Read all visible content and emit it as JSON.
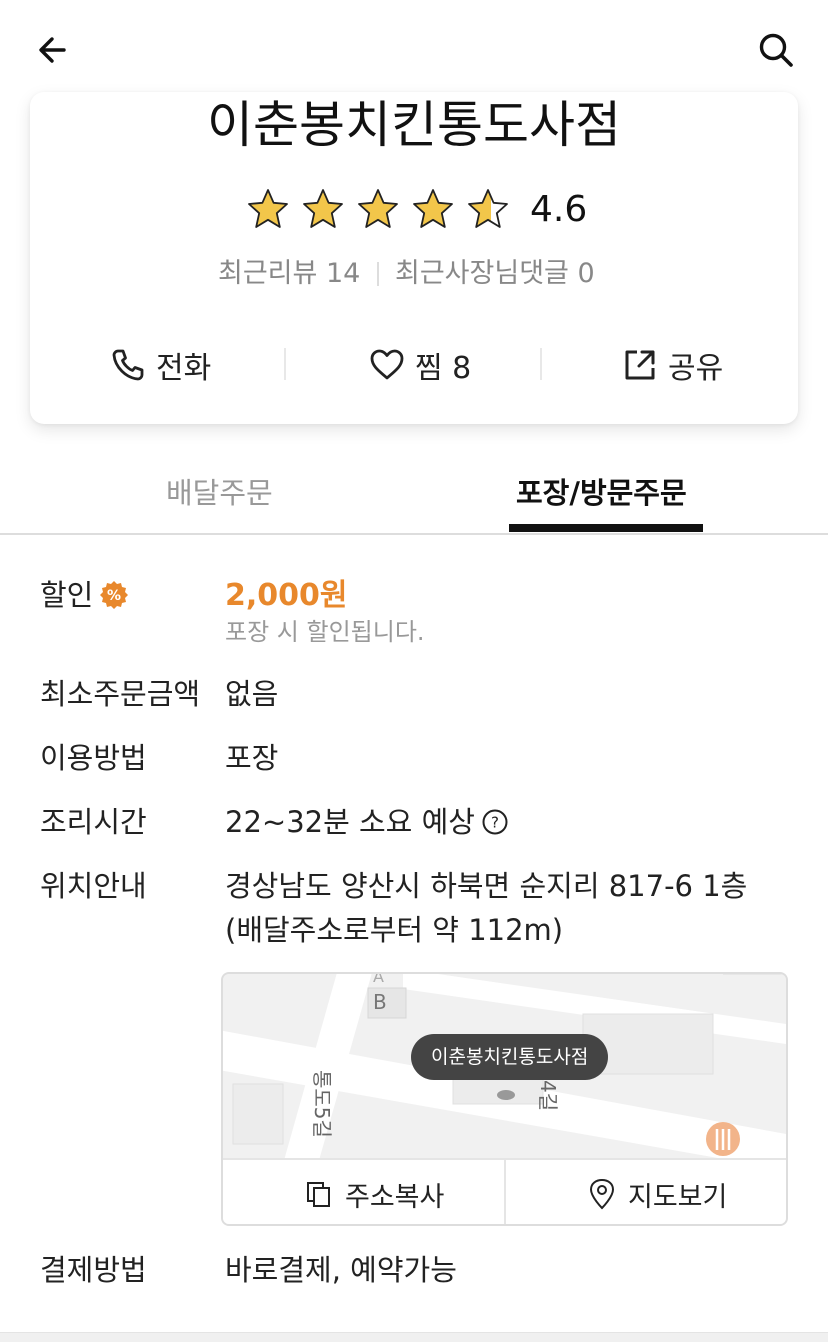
{
  "header": {
    "back_icon": "arrow-left-icon",
    "search_icon": "search-icon"
  },
  "store": {
    "name": "이춘봉치킨통도사점",
    "rating": 4.6,
    "rating_text": "4.6",
    "recent_reviews": "최근리뷰 14",
    "recent_owner_replies": "최근사장님댓글 0"
  },
  "actions": [
    {
      "label": "전화",
      "icon": "phone-icon"
    },
    {
      "label": "찜 8",
      "icon": "heart-icon"
    },
    {
      "label": "공유",
      "icon": "share-icon"
    }
  ],
  "tabs": [
    {
      "label": "배달주문",
      "active": false
    },
    {
      "label": "포장/방문주문",
      "active": true
    }
  ],
  "info": {
    "discount_label": "할인",
    "discount_value": "2,000원",
    "discount_note": "포장 시 할인됩니다.",
    "min_order_label": "최소주문금액",
    "min_order_value": "없음",
    "usage_label": "이용방법",
    "usage_value": "포장",
    "cook_time_label": "조리시간",
    "cook_time_value": "22~32분 소요 예상",
    "location_label": "위치안내",
    "address_line1": "경상남도 양산시 하북면 순지리 817-6 1층",
    "address_line2": "(배달주소로부터 약 112m)",
    "payment_label": "결제방법",
    "payment_value": "바로결제, 예약가능"
  },
  "map": {
    "pin_label": "이춘봉치킨통도사점",
    "street_label_1": "통도5길",
    "street_label_2": "4길",
    "block_label": "B",
    "block_label_top": "A",
    "copy_address": "주소복사",
    "view_map": "지도보기"
  },
  "colors": {
    "accent_orange": "#e8882c",
    "star_fill": "#f2c64a",
    "tab_active": "#111111"
  }
}
